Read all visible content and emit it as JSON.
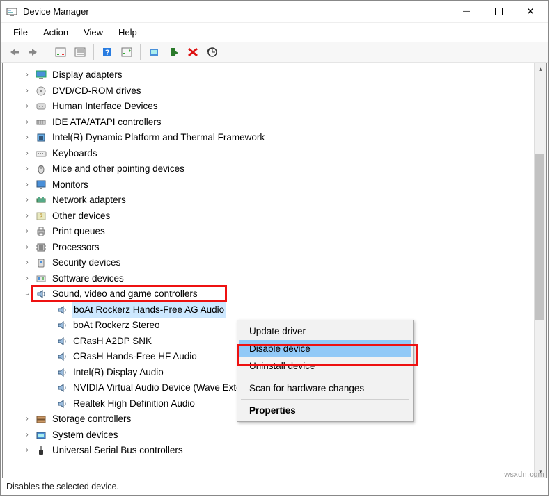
{
  "window": {
    "title": "Device Manager"
  },
  "menubar": {
    "items": [
      "File",
      "Action",
      "View",
      "Help"
    ]
  },
  "toolbar": {
    "icons": [
      "back",
      "forward",
      "sep",
      "show-hidden",
      "properties",
      "sep",
      "help",
      "update-driver",
      "sep",
      "enable",
      "disable",
      "uninstall",
      "scan-hardware"
    ]
  },
  "tree": {
    "categories": [
      {
        "label": "Display adapters",
        "icon": "display"
      },
      {
        "label": "DVD/CD-ROM drives",
        "icon": "disc"
      },
      {
        "label": "Human Interface Devices",
        "icon": "hid"
      },
      {
        "label": "IDE ATA/ATAPI controllers",
        "icon": "ide"
      },
      {
        "label": "Intel(R) Dynamic Platform and Thermal Framework",
        "icon": "chip"
      },
      {
        "label": "Keyboards",
        "icon": "keyboard"
      },
      {
        "label": "Mice and other pointing devices",
        "icon": "mouse"
      },
      {
        "label": "Monitors",
        "icon": "monitor"
      },
      {
        "label": "Network adapters",
        "icon": "network"
      },
      {
        "label": "Other devices",
        "icon": "other"
      },
      {
        "label": "Print queues",
        "icon": "printer"
      },
      {
        "label": "Processors",
        "icon": "cpu"
      },
      {
        "label": "Security devices",
        "icon": "security"
      },
      {
        "label": "Software devices",
        "icon": "software"
      }
    ],
    "sound_category": {
      "label": "Sound, video and game controllers",
      "icon": "sound",
      "expanded": true,
      "highlighted": true
    },
    "sound_children": [
      {
        "label": "boAt Rockerz Hands-Free AG Audio",
        "selected": true
      },
      {
        "label": "boAt Rockerz Stereo"
      },
      {
        "label": "CRasH A2DP SNK"
      },
      {
        "label": "CRasH Hands-Free HF Audio"
      },
      {
        "label": "Intel(R) Display Audio"
      },
      {
        "label": "NVIDIA Virtual Audio Device (Wave Extensible) (WDM)"
      },
      {
        "label": "Realtek High Definition Audio"
      }
    ],
    "post_categories": [
      {
        "label": "Storage controllers",
        "icon": "storage"
      },
      {
        "label": "System devices",
        "icon": "system"
      },
      {
        "label": "Universal Serial Bus controllers",
        "icon": "usb"
      }
    ]
  },
  "context_menu": {
    "items": [
      {
        "label": "Update driver"
      },
      {
        "label": "Disable device",
        "hover": true,
        "highlighted": true
      },
      {
        "label": "Uninstall device"
      },
      {
        "sep": true
      },
      {
        "label": "Scan for hardware changes"
      },
      {
        "sep": true
      },
      {
        "label": "Properties",
        "bold": true
      }
    ]
  },
  "statusbar": {
    "text": "Disables the selected device."
  },
  "watermark": "wsxdn.com"
}
